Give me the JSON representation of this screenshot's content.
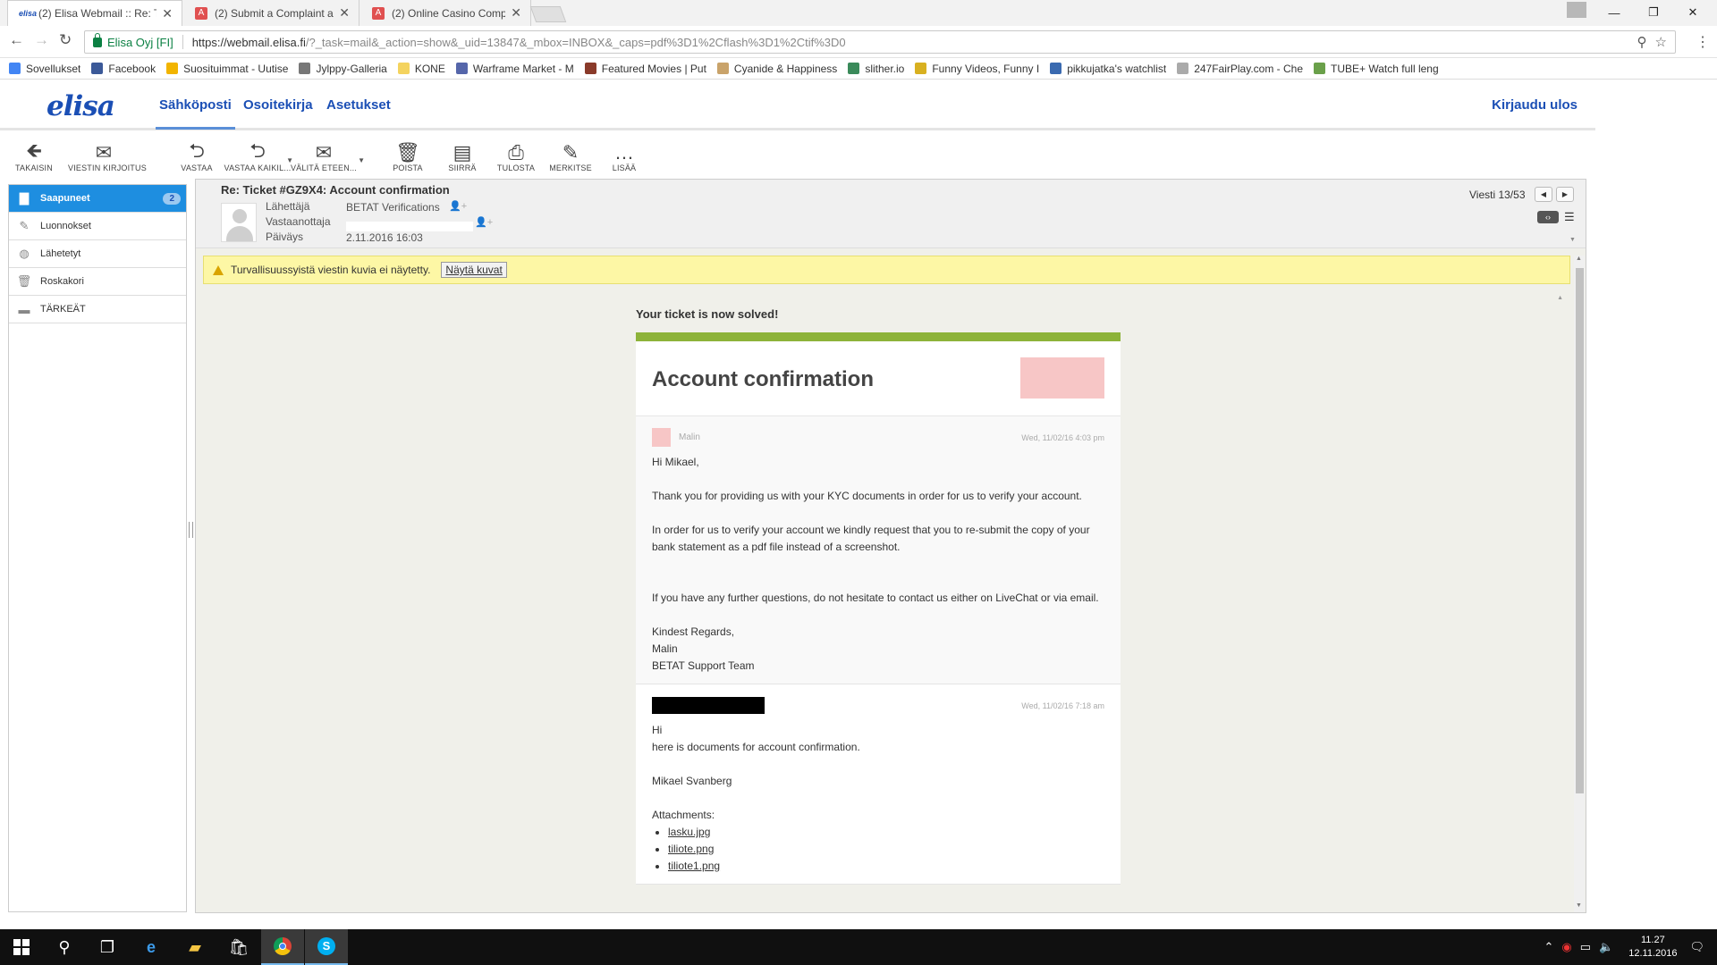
{
  "browser": {
    "tabs": [
      {
        "title": "(2) Elisa Webmail :: Re: Ti",
        "active": true
      },
      {
        "title": "(2) Submit a Complaint a",
        "active": false
      },
      {
        "title": "(2) Online Casino Compl",
        "active": false
      }
    ],
    "site_identity": "Elisa Oyj [FI]",
    "url_host": "https://webmail.elisa.fi",
    "url_path": "/?_task=mail&_action=show&_uid=13847&_mbox=INBOX&_caps=pdf%3D1%2Cflash%3D1%2Ctif%3D0",
    "bookmarks": [
      {
        "label": "Sovellukset",
        "icon": "apps-grid-icon",
        "color": "#4285f4"
      },
      {
        "label": "Facebook",
        "icon": "facebook-icon",
        "color": "#3b5998"
      },
      {
        "label": "Suosituimmat - Uutise",
        "icon": "star-icon",
        "color": "#f2b400"
      },
      {
        "label": "Jylppy-Galleria",
        "icon": "figure-icon",
        "color": "#777777"
      },
      {
        "label": "KONE",
        "icon": "folder-icon",
        "color": "#f4d35e"
      },
      {
        "label": "Warframe Market - M",
        "icon": "warframe-icon",
        "color": "#5566aa"
      },
      {
        "label": "Featured Movies | Put",
        "icon": "film-icon",
        "color": "#8a3a2a"
      },
      {
        "label": "Cyanide & Happiness",
        "icon": "cyanide-icon",
        "color": "#c9a36a"
      },
      {
        "label": "slither.io",
        "icon": "slither-icon",
        "color": "#3a8a5a"
      },
      {
        "label": "Funny Videos, Funny I",
        "icon": "troll-icon",
        "color": "#d8b020"
      },
      {
        "label": "pikkujatka's watchlist",
        "icon": "cloud-icon",
        "color": "#3a6ab0"
      },
      {
        "label": "247FairPlay.com - Che",
        "icon": "page-icon",
        "color": "#aaaaaa"
      },
      {
        "label": "TUBE+ Watch full leng",
        "icon": "tube-icon",
        "color": "#6aa04a"
      }
    ]
  },
  "app": {
    "logo_text": "elisa",
    "nav": [
      {
        "label": "Sähköposti",
        "selected": true
      },
      {
        "label": "Osoitekirja",
        "selected": false
      },
      {
        "label": "Asetukset",
        "selected": false
      }
    ],
    "logout_label": "Kirjaudu ulos",
    "toolbar": [
      {
        "label": "TAKAISIN",
        "icon": "back-arrow-icon"
      },
      {
        "label": "VIESTIN KIRJOITUS",
        "icon": "compose-icon"
      },
      {
        "label": "VASTAA",
        "icon": "reply-icon"
      },
      {
        "label": "VASTAA KAIKIL...",
        "icon": "reply-all-icon"
      },
      {
        "label": "VÄLITÄ ETEEN...",
        "icon": "forward-icon"
      },
      {
        "label": "POISTA",
        "icon": "trash-icon"
      },
      {
        "label": "SIIRRÄ",
        "icon": "move-icon"
      },
      {
        "label": "TULOSTA",
        "icon": "print-icon"
      },
      {
        "label": "MERKITSE",
        "icon": "mark-icon"
      },
      {
        "label": "LISÄÄ",
        "icon": "more-icon"
      }
    ],
    "folders": [
      {
        "label": "Saapuneet",
        "badge": "2",
        "selected": true,
        "icon": "inbox-icon"
      },
      {
        "label": "Luonnokset",
        "badge": "",
        "selected": false,
        "icon": "pencil-icon"
      },
      {
        "label": "Lähetetyt",
        "badge": "",
        "selected": false,
        "icon": "sent-icon"
      },
      {
        "label": "Roskakori",
        "badge": "",
        "selected": false,
        "icon": "trash-icon"
      },
      {
        "label": "TÄRKEÄT",
        "badge": "",
        "selected": false,
        "icon": "folder-icon"
      }
    ]
  },
  "message": {
    "subject": "Re: Ticket #GZ9X4: Account confirmation",
    "from_label": "Lähettäjä",
    "from_value": "BETAT Verifications",
    "to_label": "Vastaanottaja",
    "date_label": "Päiväys",
    "date_value": "2.11.2016 16:03",
    "counter": "Viesti 13/53",
    "security_warning": "Turvallisuussyistä viestin kuvia ei näytetty.",
    "show_images_label": "Näytä kuvat"
  },
  "email": {
    "solved_heading": "Your ticket is now solved!",
    "card_title": "Account confirmation",
    "reply": {
      "author": "Malin",
      "date": "Wed, 11/02/16 4:03 pm",
      "greeting": "Hi Mikael,",
      "para1": "Thank you for providing us with your KYC documents in order for us to verify your account.",
      "para2": "In order for us to verify your account we kindly request that you to re-submit the copy of your bank statement as a pdf file instead of a screenshot.",
      "para3": "If you have any further questions, do not hesitate to contact us either on LiveChat or via email.",
      "sign1": "Kindest Regards,",
      "sign2": "Malin",
      "sign3": "BETAT Support Team"
    },
    "original": {
      "date": "Wed, 11/02/16 7:18 am",
      "line1": "Hi",
      "line2": "here is documents for account confirmation.",
      "name": "Mikael Svanberg",
      "attachments_label": "Attachments:",
      "attachments": [
        "lasku.jpg",
        "tiliote.png",
        "tiliote1.png"
      ]
    }
  },
  "taskbar": {
    "time": "11.27",
    "date": "12.11.2016"
  },
  "colors": {
    "elisa_blue": "#1b4fb5",
    "selected_folder": "#1e8ee0",
    "ticket_green": "#8db33a",
    "warning_yellow": "#fdf7a5"
  }
}
